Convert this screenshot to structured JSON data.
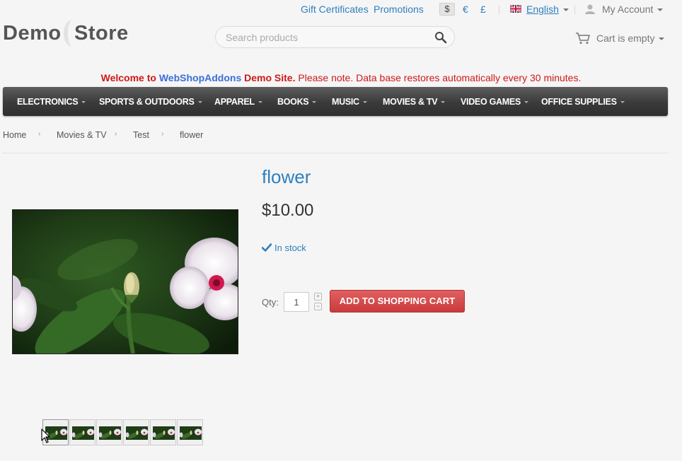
{
  "header": {
    "links": {
      "gift_certificates": "Gift Certificates",
      "promotions": "Promotions"
    },
    "currencies": [
      "$",
      "€",
      "£"
    ],
    "selected_currency": "$",
    "language": "English",
    "account": "My Account",
    "logo": {
      "part1": "Demo",
      "part2": "Store"
    },
    "search_placeholder": "Search products",
    "cart": "Cart is empty"
  },
  "welcome": {
    "part1": "Welcome to",
    "brand": "WebShopAddons",
    "part2": "Demo Site.",
    "note": "Please note. Data base restores automatically every 30 minutes."
  },
  "nav": [
    "ELECTRONICS",
    "SPORTS & OUTDOORS",
    "APPAREL",
    "BOOKS",
    "MUSIC",
    "MOVIES & TV",
    "VIDEO GAMES",
    "OFFICE SUPPLIES"
  ],
  "breadcrumb": [
    "Home",
    "Movies & TV",
    "Test",
    "flower"
  ],
  "product": {
    "title": "flower",
    "price": "$10.00",
    "stock": "In stock",
    "qty_label": "Qty:",
    "qty_value": "1",
    "add_to_cart": "ADD TO SHOPPING CART",
    "thumbnail_count": 6
  },
  "icons": {
    "search": "search-icon",
    "cart": "cart-icon",
    "user": "user-icon",
    "flag": "uk-flag-icon",
    "stock": "checkmark-icon",
    "cursor": "mouse-cursor-icon"
  },
  "colors": {
    "link_blue": "#2f7fbe",
    "welcome_red": "#d01818",
    "brand_blue": "#3b6fd8",
    "nav_dark": "#3a3a3a",
    "button_red": "#c83b3b"
  }
}
